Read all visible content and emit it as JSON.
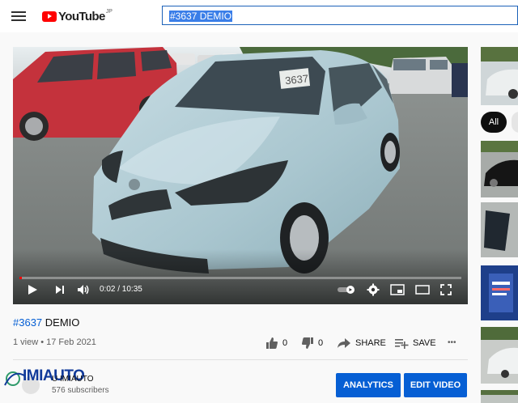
{
  "header": {
    "logo_text": "YouTube",
    "logo_region": "JP",
    "search_value": "#3637 DEMIO"
  },
  "player": {
    "time": "0:02 / 10:35",
    "progress_fraction": 0.003,
    "windshield_tag": "3637"
  },
  "video": {
    "title_tag": "#3637",
    "title_rest": " DEMIO",
    "meta": "1 view • 17 Feb 2021",
    "likes": "0",
    "dislikes": "0",
    "share_label": "SHARE",
    "save_label": "SAVE",
    "more_label": "•••"
  },
  "channel": {
    "name": "U IMIAUTO",
    "subscribers": "576 subscribers",
    "watermark": "IMIAUTO"
  },
  "buttons": {
    "analytics": "ANALYTICS",
    "edit_video": "EDIT VIDEO"
  },
  "sidebar": {
    "chip_all": "All"
  },
  "colors": {
    "accent": "#065fd4",
    "logo_red": "#ff0000",
    "car_body": "#b4cfd8"
  }
}
